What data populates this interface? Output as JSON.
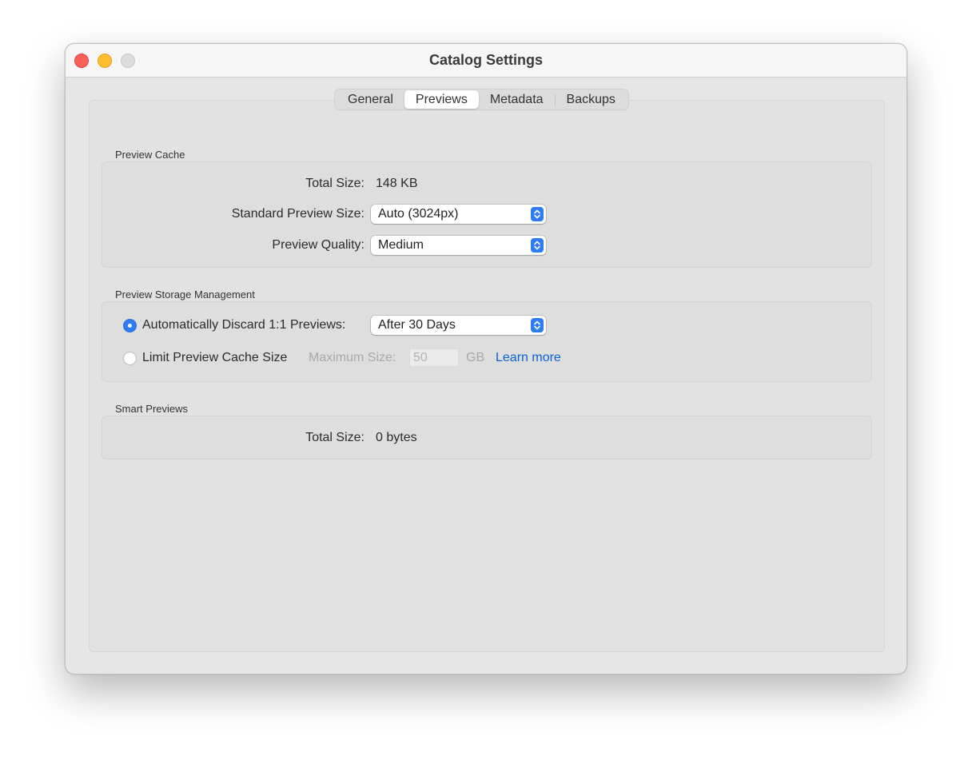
{
  "window": {
    "title": "Catalog Settings"
  },
  "tabs": [
    {
      "label": "General",
      "active": false
    },
    {
      "label": "Previews",
      "active": true
    },
    {
      "label": "Metadata",
      "active": false
    },
    {
      "label": "Backups",
      "active": false
    }
  ],
  "preview_cache": {
    "section_title": "Preview Cache",
    "total_size_label": "Total Size:",
    "total_size_value": "148 KB",
    "standard_preview_size_label": "Standard Preview Size:",
    "standard_preview_size_value": "Auto (3024px)",
    "preview_quality_label": "Preview Quality:",
    "preview_quality_value": "Medium"
  },
  "storage_management": {
    "section_title": "Preview Storage Management",
    "auto_discard_label": "Automatically Discard 1:1 Previews:",
    "auto_discard_selected": true,
    "auto_discard_value": "After 30 Days",
    "limit_cache_label": "Limit Preview Cache Size",
    "limit_cache_selected": false,
    "maximum_size_label": "Maximum Size:",
    "maximum_size_value": "50",
    "maximum_size_unit": "GB",
    "learn_more_link": "Learn more"
  },
  "smart_previews": {
    "section_title": "Smart Previews",
    "total_size_label": "Total Size:",
    "total_size_value": "0 bytes"
  },
  "colors": {
    "accent": "#2f7cf6",
    "link": "#0b5fd6",
    "close": "#fe5f57",
    "minimize": "#febc2e"
  }
}
